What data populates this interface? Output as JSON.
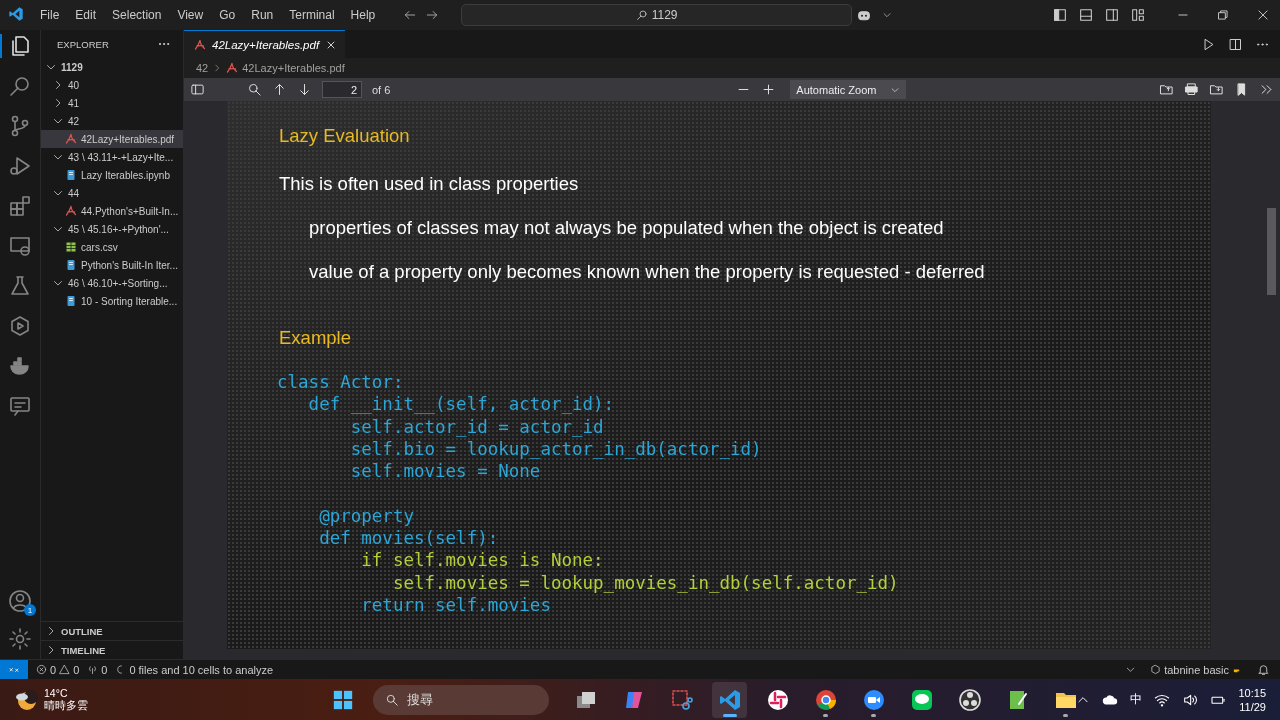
{
  "menu": [
    "File",
    "Edit",
    "Selection",
    "View",
    "Go",
    "Run",
    "Terminal",
    "Help"
  ],
  "command_center": {
    "value": "1129"
  },
  "activity_bar": [
    {
      "kind": "explorer",
      "selected": true
    },
    {
      "kind": "search",
      "selected": false
    },
    {
      "kind": "source-control",
      "selected": false
    },
    {
      "kind": "run",
      "selected": false
    },
    {
      "kind": "extensions",
      "selected": false
    },
    {
      "kind": "remote",
      "selected": false
    },
    {
      "kind": "testing",
      "selected": false
    },
    {
      "kind": "cube",
      "selected": false
    },
    {
      "kind": "docker",
      "selected": false
    },
    {
      "kind": "chat",
      "selected": false
    }
  ],
  "account_badge": "1",
  "explorer": {
    "title": "EXPLORER",
    "root": {
      "label": "1129",
      "kind": "folder",
      "expanded": true,
      "children": [
        {
          "label": "40",
          "kind": "folder",
          "expanded": false
        },
        {
          "label": "41",
          "kind": "folder",
          "expanded": false
        },
        {
          "label": "42",
          "kind": "folder",
          "expanded": true,
          "children": [
            {
              "label": "42Lazy+Iterables.pdf",
              "kind": "pdf",
              "selected": true
            }
          ]
        },
        {
          "label": "43 \\ 43.11+-+Lazy+Ite...",
          "kind": "folder",
          "expanded": true,
          "children": [
            {
              "label": "Lazy Iterables.ipynb",
              "kind": "notebook",
              "selected": false
            }
          ]
        },
        {
          "label": "44",
          "kind": "folder",
          "expanded": true,
          "children": [
            {
              "label": "44.Python's+Built-In...",
              "kind": "pdf",
              "selected": false
            }
          ]
        },
        {
          "label": "45 \\ 45.16+-+Python'...",
          "kind": "folder",
          "expanded": true,
          "children": [
            {
              "label": "cars.csv",
              "kind": "csv",
              "selected": false
            },
            {
              "label": "Python's Built-In Iter...",
              "kind": "notebook",
              "selected": false
            }
          ]
        },
        {
          "label": "46 \\ 46.10+-+Sorting...",
          "kind": "folder",
          "expanded": true,
          "children": [
            {
              "label": "10 - Sorting Iterable...",
              "kind": "notebook",
              "selected": false
            }
          ]
        }
      ]
    },
    "sections": [
      {
        "label": "OUTLINE",
        "expanded": false
      },
      {
        "label": "TIMELINE",
        "expanded": false
      }
    ]
  },
  "tabs": [
    {
      "label": "42Lazy+Iterables.pdf",
      "selected": true,
      "preview": true
    }
  ],
  "breadcrumb": [
    "42",
    "42Lazy+Iterables.pdf"
  ],
  "pdf_toolbar": {
    "page": "2",
    "page_count": "of 6",
    "zoom": "Automatic Zoom"
  },
  "slide": {
    "heading": "Lazy Evaluation",
    "points": [
      {
        "text": "This is often used in class properties",
        "children": [
          {
            "text": "properties of classes may not always be populated when the object is created"
          },
          {
            "text": "value of a property only becomes known when the property is requested - deferred"
          }
        ]
      }
    ],
    "example_heading": "Example",
    "code": [
      {
        "text": "class Actor:",
        "color": "#2ba6d6"
      },
      {
        "text": "   def __init__(self, actor_id):",
        "color": "#2ba6d6"
      },
      {
        "text": "       self.actor_id = actor_id",
        "color": "#2ba6d6"
      },
      {
        "text": "       self.bio = lookup_actor_in_db(actor_id)",
        "color": "#2ba6d6"
      },
      {
        "text": "       self.movies = None",
        "color": "#2ba6d6"
      },
      {
        "text": "    @property",
        "color": "#2ba6d6",
        "blank_before": true
      },
      {
        "text": "    def movies(self):",
        "color": "#2ba6d6"
      },
      {
        "text": "        if self.movies is None:",
        "color": "#b3cf3a"
      },
      {
        "text": "           self.movies = lookup_movies_in_db(self.actor_id)",
        "color": "#b3cf3a"
      },
      {
        "text": "        return self.movies",
        "color": "#2ba6d6"
      }
    ]
  },
  "status_bar": {
    "errors": "0",
    "warnings": "0",
    "ports": "0",
    "analysis": "0 files and 10 cells to analyze",
    "tabnine": "tabnine basic"
  },
  "taskbar": {
    "weather": {
      "temp": "14°C",
      "desc": "晴時多雲"
    },
    "search_placeholder": "搜尋",
    "apps": [
      {
        "kind": "windows-stack",
        "running": false,
        "selected": false
      },
      {
        "kind": "copilot",
        "running": false,
        "selected": false
      },
      {
        "kind": "snipping",
        "running": false,
        "selected": false
      },
      {
        "kind": "vscode",
        "running": true,
        "selected": true
      },
      {
        "kind": "slack",
        "running": false,
        "selected": false
      },
      {
        "kind": "chrome",
        "running": true,
        "selected": false
      },
      {
        "kind": "zoom",
        "running": true,
        "selected": false
      },
      {
        "kind": "line",
        "running": false,
        "selected": false
      },
      {
        "kind": "obs",
        "running": false,
        "selected": false
      },
      {
        "kind": "notepad",
        "running": false,
        "selected": false
      },
      {
        "kind": "folder",
        "running": true,
        "selected": false
      }
    ],
    "ime": "中",
    "time": "10:15",
    "date": "11/29"
  }
}
